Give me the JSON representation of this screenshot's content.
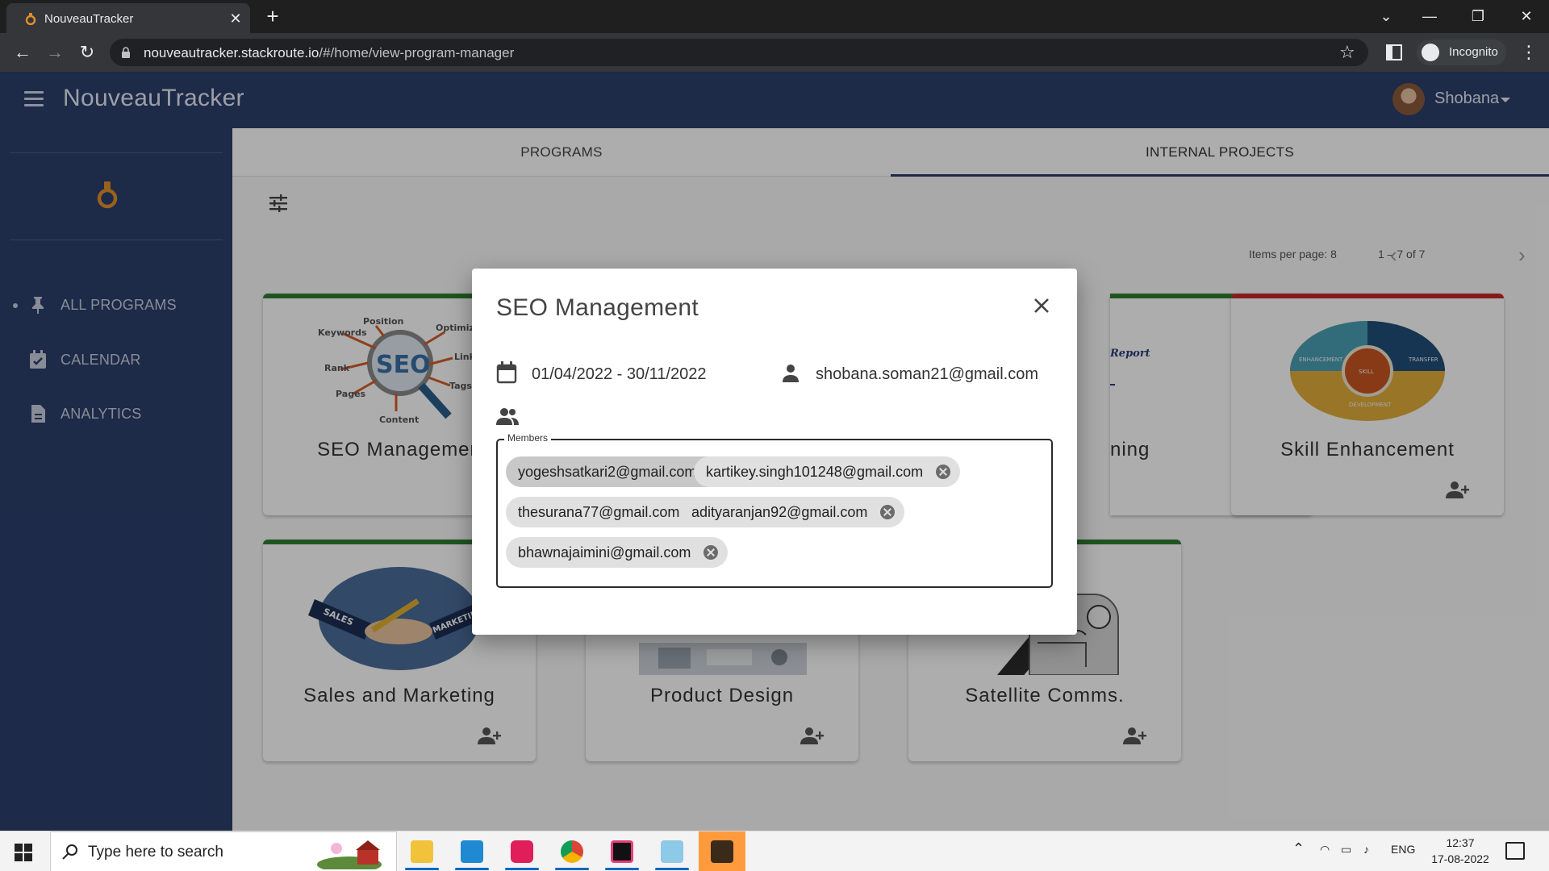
{
  "browser": {
    "tab_title": "NouveauTracker",
    "url_host": "nouveautracker.stackroute.io",
    "url_path": "/#/home/view-program-manager",
    "profile_label": "Incognito"
  },
  "app": {
    "brand": "NouveauTracker",
    "user_name": "Shobana",
    "accent_color": "#2c3e6b"
  },
  "sidebar": {
    "items": [
      {
        "label": "ALL PROGRAMS",
        "icon": "pin-icon"
      },
      {
        "label": "CALENDAR",
        "icon": "calendar-check-icon"
      },
      {
        "label": "ANALYTICS",
        "icon": "document-icon"
      }
    ]
  },
  "tabs": [
    {
      "label": "PROGRAMS"
    },
    {
      "label": "INTERNAL PROJECTS"
    }
  ],
  "paginator": {
    "items_per_page_label": "Items per page: 8",
    "range_label": "1 – 7 of 7"
  },
  "cards": [
    {
      "title": "SEO Managemen",
      "status_color": "#2e7d32"
    },
    {
      "title": "ning",
      "status_color": "#2e7d32"
    },
    {
      "title": "Skill Enhancement",
      "status_color": "#c62828"
    },
    {
      "title": "Sales and Marketing",
      "status_color": "#2e7d32"
    },
    {
      "title": "Product Design",
      "status_color": "#2e7d32"
    },
    {
      "title": "Satellite Comms.",
      "status_color": "#2e7d32"
    }
  ],
  "modal": {
    "title": "SEO Management",
    "date_range": "01/04/2022 - 30/11/2022",
    "owner_email": "shobana.soman21@gmail.com",
    "members_label": "Members",
    "members": [
      "yogeshsatkari2@gmail.com",
      "kartikey.singh101248@gmail.com",
      "thesurana77@gmail.com",
      "adityaranjan92@gmail.com",
      "bhawnajaimini@gmail.com"
    ]
  },
  "taskbar": {
    "search_placeholder": "Type here to search",
    "language": "ENG",
    "time": "12:37",
    "date": "17-08-2022"
  }
}
